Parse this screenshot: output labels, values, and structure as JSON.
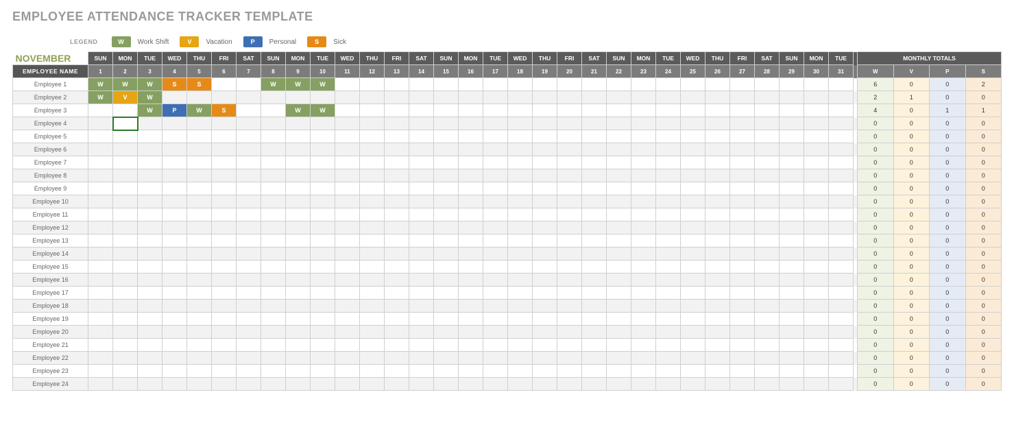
{
  "title": "EMPLOYEE ATTENDANCE TRACKER TEMPLATE",
  "legend": {
    "label": "LEGEND",
    "items": {
      "w": {
        "code": "W",
        "text": "Work Shift"
      },
      "v": {
        "code": "V",
        "text": "Vacation"
      },
      "p": {
        "code": "P",
        "text": "Personal"
      },
      "s": {
        "code": "S",
        "text": "Sick"
      }
    }
  },
  "month": "NOVEMBER",
  "header": {
    "employee_name": "EMPLOYEE NAME",
    "dows": [
      "SUN",
      "MON",
      "TUE",
      "WED",
      "THU",
      "FRI",
      "SAT",
      "SUN",
      "MON",
      "TUE",
      "WED",
      "THU",
      "FRI",
      "SAT",
      "SUN",
      "MON",
      "TUE",
      "WED",
      "THU",
      "FRI",
      "SAT",
      "SUN",
      "MON",
      "TUE",
      "WED",
      "THU",
      "FRI",
      "SAT",
      "SUN",
      "MON",
      "TUE"
    ],
    "days": [
      "1",
      "2",
      "3",
      "4",
      "5",
      "6",
      "7",
      "8",
      "9",
      "10",
      "11",
      "12",
      "13",
      "14",
      "15",
      "16",
      "17",
      "18",
      "19",
      "20",
      "21",
      "22",
      "23",
      "24",
      "25",
      "26",
      "27",
      "28",
      "29",
      "30",
      "31"
    ],
    "monthly_totals": "MONTHLY TOTALS",
    "total_cols": [
      "W",
      "V",
      "P",
      "S"
    ]
  },
  "dropdown": {
    "options": [
      "W",
      "V",
      "P",
      "S"
    ]
  },
  "employees": [
    {
      "name": "Employee 1",
      "marks": {
        "1": "W",
        "2": "W",
        "3": "W",
        "4": "S",
        "5": "S",
        "8": "W",
        "9": "W",
        "10": "W"
      },
      "totals": {
        "w": "6",
        "v": "0",
        "p": "0",
        "s": "2"
      }
    },
    {
      "name": "Employee 2",
      "marks": {
        "1": "W",
        "2": "V",
        "3": "W"
      },
      "totals": {
        "w": "2",
        "v": "1",
        "p": "0",
        "s": "0"
      }
    },
    {
      "name": "Employee 3",
      "marks": {
        "3": "W",
        "4": "P",
        "5": "W",
        "6": "S",
        "9": "W",
        "10": "W"
      },
      "totals": {
        "w": "4",
        "v": "0",
        "p": "1",
        "s": "1"
      }
    },
    {
      "name": "Employee 4",
      "marks": {},
      "totals": {
        "w": "0",
        "v": "0",
        "p": "0",
        "s": "0"
      },
      "activeCellDay": "2"
    },
    {
      "name": "Employee 5",
      "marks": {},
      "totals": {
        "w": "0",
        "v": "0",
        "p": "0",
        "s": "0"
      }
    },
    {
      "name": "Employee 6",
      "marks": {},
      "totals": {
        "w": "0",
        "v": "0",
        "p": "0",
        "s": "0"
      }
    },
    {
      "name": "Employee 7",
      "marks": {},
      "totals": {
        "w": "0",
        "v": "0",
        "p": "0",
        "s": "0"
      }
    },
    {
      "name": "Employee 8",
      "marks": {},
      "totals": {
        "w": "0",
        "v": "0",
        "p": "0",
        "s": "0"
      }
    },
    {
      "name": "Employee 9",
      "marks": {},
      "totals": {
        "w": "0",
        "v": "0",
        "p": "0",
        "s": "0"
      }
    },
    {
      "name": "Employee 10",
      "marks": {},
      "totals": {
        "w": "0",
        "v": "0",
        "p": "0",
        "s": "0"
      }
    },
    {
      "name": "Employee 11",
      "marks": {},
      "totals": {
        "w": "0",
        "v": "0",
        "p": "0",
        "s": "0"
      }
    },
    {
      "name": "Employee 12",
      "marks": {},
      "totals": {
        "w": "0",
        "v": "0",
        "p": "0",
        "s": "0"
      }
    },
    {
      "name": "Employee 13",
      "marks": {},
      "totals": {
        "w": "0",
        "v": "0",
        "p": "0",
        "s": "0"
      }
    },
    {
      "name": "Employee 14",
      "marks": {},
      "totals": {
        "w": "0",
        "v": "0",
        "p": "0",
        "s": "0"
      }
    },
    {
      "name": "Employee 15",
      "marks": {},
      "totals": {
        "w": "0",
        "v": "0",
        "p": "0",
        "s": "0"
      }
    },
    {
      "name": "Employee 16",
      "marks": {},
      "totals": {
        "w": "0",
        "v": "0",
        "p": "0",
        "s": "0"
      }
    },
    {
      "name": "Employee 17",
      "marks": {},
      "totals": {
        "w": "0",
        "v": "0",
        "p": "0",
        "s": "0"
      }
    },
    {
      "name": "Employee 18",
      "marks": {},
      "totals": {
        "w": "0",
        "v": "0",
        "p": "0",
        "s": "0"
      }
    },
    {
      "name": "Employee 19",
      "marks": {},
      "totals": {
        "w": "0",
        "v": "0",
        "p": "0",
        "s": "0"
      }
    },
    {
      "name": "Employee 20",
      "marks": {},
      "totals": {
        "w": "0",
        "v": "0",
        "p": "0",
        "s": "0"
      }
    },
    {
      "name": "Employee 21",
      "marks": {},
      "totals": {
        "w": "0",
        "v": "0",
        "p": "0",
        "s": "0"
      }
    },
    {
      "name": "Employee 22",
      "marks": {},
      "totals": {
        "w": "0",
        "v": "0",
        "p": "0",
        "s": "0"
      }
    },
    {
      "name": "Employee 23",
      "marks": {},
      "totals": {
        "w": "0",
        "v": "0",
        "p": "0",
        "s": "0"
      }
    },
    {
      "name": "Employee 24",
      "marks": {},
      "totals": {
        "w": "0",
        "v": "0",
        "p": "0",
        "s": "0"
      }
    }
  ]
}
